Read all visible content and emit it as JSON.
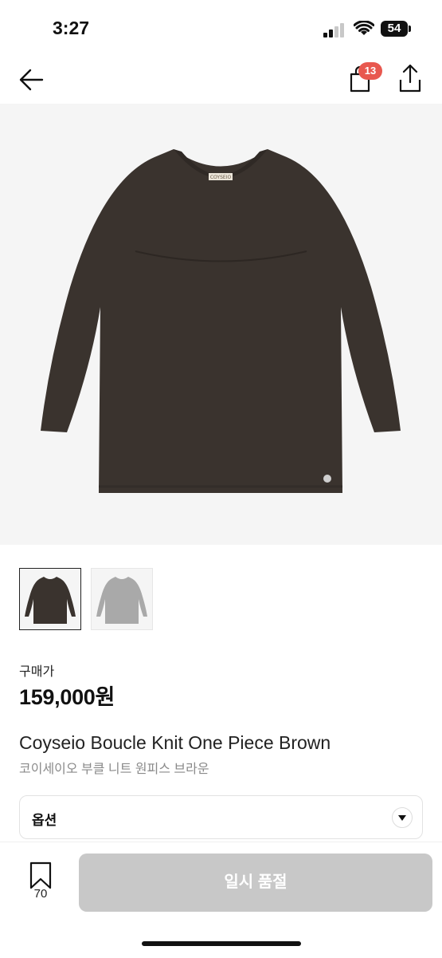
{
  "status": {
    "time": "3:27",
    "battery": "54"
  },
  "nav": {
    "cart_count": "13"
  },
  "product": {
    "brand_tag": "COYSEIO",
    "price_label": "구매가",
    "price": "159,000원",
    "title_en": "Coyseio Boucle Knit One Piece Brown",
    "title_ko": "코이세이오 부클 니트 원피스 브라운",
    "main_color": "#3a332e",
    "alt_color": "#a9a9a9"
  },
  "options": {
    "label": "옵션"
  },
  "bottom": {
    "bookmark_count": "70",
    "cta_label": "일시 품절"
  },
  "colors": {
    "badge": "#e8584f",
    "disabled_button": "#c8c8c8"
  }
}
